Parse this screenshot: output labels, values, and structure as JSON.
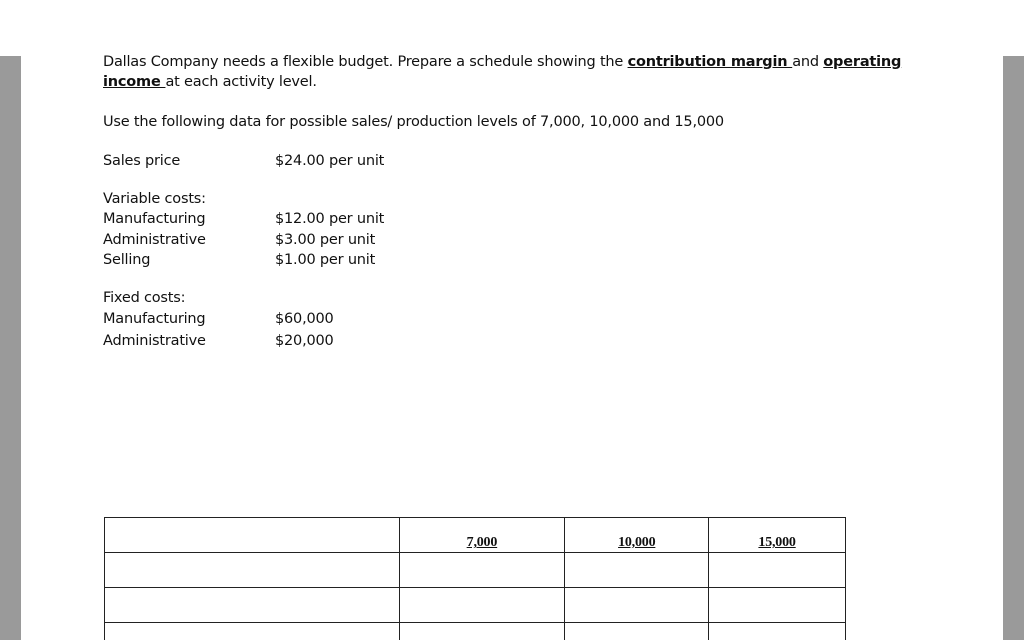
{
  "intro": {
    "part1": "Dallas Company needs a flexible budget.  Prepare a schedule showing the ",
    "term1": "contribution margin ",
    "part2": "and ",
    "term2": "operating",
    "term2b": "income ",
    "part3": "at each activity level."
  },
  "instruction": "Use the following data for possible sales/ production levels of 7,000, 10,000 and 15,000",
  "sales_price": {
    "label": "Sales price",
    "value": "$24.00 per unit"
  },
  "variable_costs": {
    "heading": "Variable costs:",
    "items": [
      {
        "label": "Manufacturing",
        "value": "$12.00 per unit"
      },
      {
        "label": "Administrative",
        "value": "$3.00 per unit"
      },
      {
        "label": "Selling",
        "value": "$1.00 per unit"
      }
    ]
  },
  "fixed_costs": {
    "heading": "Fixed costs:",
    "items": [
      {
        "label": "Manufacturing",
        "value": "$60,000"
      },
      {
        "label": "Administrative",
        "value": "$20,000"
      }
    ]
  },
  "schedule": {
    "headers": [
      "",
      "7,000",
      "10,000",
      "15,000"
    ]
  }
}
